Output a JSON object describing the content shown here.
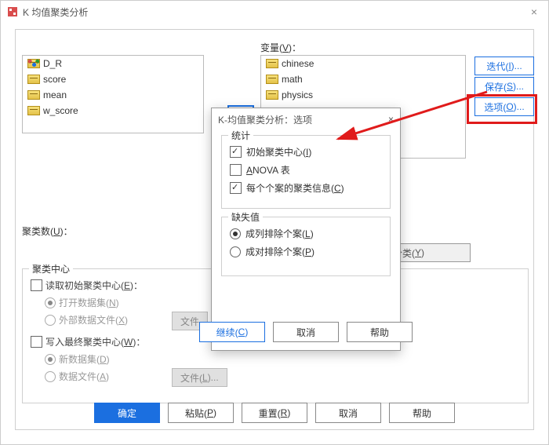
{
  "main": {
    "title": "K 均值聚类分析",
    "close_glyph": "×",
    "source_items": [
      "D_R",
      "score",
      "mean",
      "w_score"
    ],
    "var_label_prefix": "变量(",
    "var_label_u": "V",
    "var_label_suffix": ")：",
    "var_items": [
      "chinese",
      "math",
      "physics"
    ],
    "side": {
      "iterate_prefix": "迭代(",
      "iterate_u": "I",
      "iterate_suffix": ")...",
      "save_prefix": "保存(",
      "save_u": "S",
      "save_suffix": ")...",
      "options_prefix": "选项(",
      "options_u": "O",
      "options_suffix": ")..."
    },
    "cluster_count_prefix": "聚类数(",
    "cluster_count_u": "U",
    "cluster_count_suffix": ")：",
    "method_only_prefix": "又分类(",
    "method_only_u": "Y",
    "method_only_suffix": ")",
    "fieldset_legend": "聚类中心",
    "read_prefix": "读取初始聚类中心(",
    "read_u": "E",
    "read_suffix": ")：",
    "open_ds_prefix": "打开数据集(",
    "open_ds_u": "N",
    "open_ds_suffix": ")",
    "ext_file_prefix": "外部数据文件(",
    "ext_file_u": "X",
    "ext_file_suffix": ")",
    "file_btn": "文件",
    "write_prefix": "写入最终聚类中心(",
    "write_u": "W",
    "write_suffix": ")：",
    "new_ds_prefix": "新数据集(",
    "new_ds_u": "D",
    "new_ds_suffix": ")",
    "data_file_prefix": "数据文件(",
    "data_file_u": "A",
    "data_file_suffix": ")",
    "file_btn2_prefix": "文件(",
    "file_btn2_u": "L",
    "file_btn2_suffix": ")...",
    "bottom": {
      "ok": "确定",
      "paste_prefix": "粘贴(",
      "paste_u": "P",
      "paste_suffix": ")",
      "reset_prefix": "重置(",
      "reset_u": "R",
      "reset_suffix": ")",
      "cancel": "取消",
      "help": "帮助"
    }
  },
  "sub": {
    "title": "K-均值聚类分析：选项",
    "close_glyph": "×",
    "stats_legend": "统计",
    "stat1_prefix": "初始聚类中心(",
    "stat1_u": "I",
    "stat1_suffix": ")",
    "stat2_prefix": "",
    "stat2_u": "A",
    "stat2_suffix": "NOVA 表",
    "stat3_prefix": "每个个案的聚类信息(",
    "stat3_u": "C",
    "stat3_suffix": ")",
    "missing_legend": "缺失值",
    "miss1_prefix": "成列排除个案(",
    "miss1_u": "L",
    "miss1_suffix": ")",
    "miss2_prefix": "成对排除个案(",
    "miss2_u": "P",
    "miss2_suffix": ")",
    "bottom": {
      "continue_prefix": "继续(",
      "continue_u": "C",
      "continue_suffix": ")",
      "cancel": "取消",
      "help": "帮助"
    }
  }
}
